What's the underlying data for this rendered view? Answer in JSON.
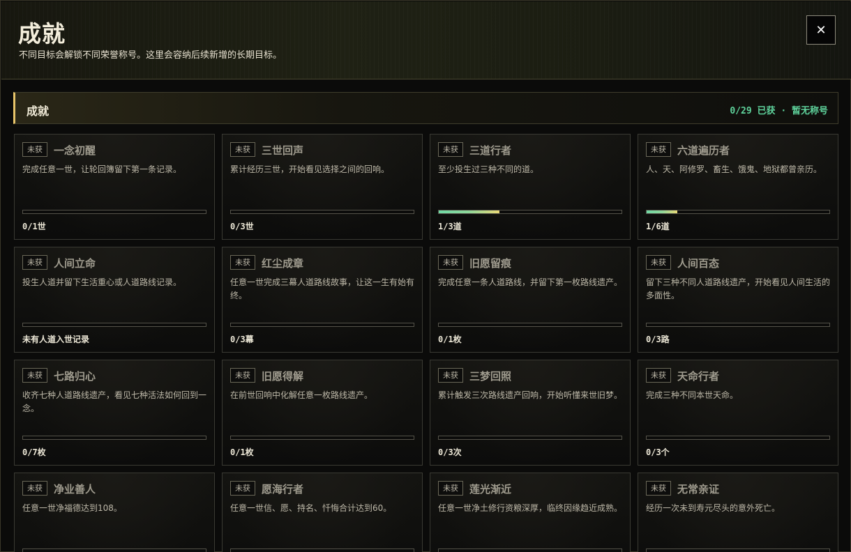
{
  "header": {
    "title": "成就",
    "subtitle": "不同目标会解锁不同荣誉称号。这里会容纳后续新增的长期目标。",
    "close_label": "✕"
  },
  "section": {
    "title": "成就",
    "stats": "0/29 已获 · 暂无称号"
  },
  "achievements": [
    {
      "badge": "未获",
      "name": "一念初醒",
      "desc": "完成任意一世，让轮回簿留下第一条记录。",
      "progress_text": "0/1世",
      "progress": 0
    },
    {
      "badge": "未获",
      "name": "三世回声",
      "desc": "累计经历三世，开始看见选择之间的回响。",
      "progress_text": "0/3世",
      "progress": 0
    },
    {
      "badge": "未获",
      "name": "三道行者",
      "desc": "至少投生过三种不同的道。",
      "progress_text": "1/3道",
      "progress": 0.333
    },
    {
      "badge": "未获",
      "name": "六道遍历者",
      "desc": "人、天、阿修罗、畜生、饿鬼、地狱都曾亲历。",
      "progress_text": "1/6道",
      "progress": 0.167
    },
    {
      "badge": "未获",
      "name": "人间立命",
      "desc": "投生人道并留下生活重心或人道路线记录。",
      "progress_text": "未有人道入世记录",
      "progress": 0
    },
    {
      "badge": "未获",
      "name": "红尘成章",
      "desc": "任意一世完成三幕人道路线故事，让这一生有始有终。",
      "progress_text": "0/3幕",
      "progress": 0
    },
    {
      "badge": "未获",
      "name": "旧愿留痕",
      "desc": "完成任意一条人道路线，并留下第一枚路线遗产。",
      "progress_text": "0/1枚",
      "progress": 0
    },
    {
      "badge": "未获",
      "name": "人间百态",
      "desc": "留下三种不同人道路线遗产，开始看见人间生活的多面性。",
      "progress_text": "0/3路",
      "progress": 0
    },
    {
      "badge": "未获",
      "name": "七路归心",
      "desc": "收齐七种人道路线遗产，看见七种活法如何回到一念。",
      "progress_text": "0/7枚",
      "progress": 0
    },
    {
      "badge": "未获",
      "name": "旧愿得解",
      "desc": "在前世回响中化解任意一枚路线遗产。",
      "progress_text": "0/1枚",
      "progress": 0
    },
    {
      "badge": "未获",
      "name": "三梦回照",
      "desc": "累计触发三次路线遗产回响，开始听懂来世旧梦。",
      "progress_text": "0/3次",
      "progress": 0
    },
    {
      "badge": "未获",
      "name": "天命行者",
      "desc": "完成三种不同本世天命。",
      "progress_text": "0/3个",
      "progress": 0
    },
    {
      "badge": "未获",
      "name": "净业善人",
      "desc": "任意一世净福德达到108。",
      "progress_text": "",
      "progress": 0
    },
    {
      "badge": "未获",
      "name": "愿海行者",
      "desc": "任意一世信、愿、持名、忏悔合计达到60。",
      "progress_text": "",
      "progress": 0
    },
    {
      "badge": "未获",
      "name": "莲光渐近",
      "desc": "任意一世净土修行资粮深厚，临终因缘趋近成熟。",
      "progress_text": "",
      "progress": 0
    },
    {
      "badge": "未获",
      "name": "无常亲证",
      "desc": "经历一次未到寿元尽头的意外死亡。",
      "progress_text": "",
      "progress": 0
    }
  ],
  "colors": {
    "accent_gold": "#e8c56a",
    "stats_green": "#5fd39c",
    "progress_start": "#6fd9a4",
    "progress_end": "#e9d876"
  }
}
